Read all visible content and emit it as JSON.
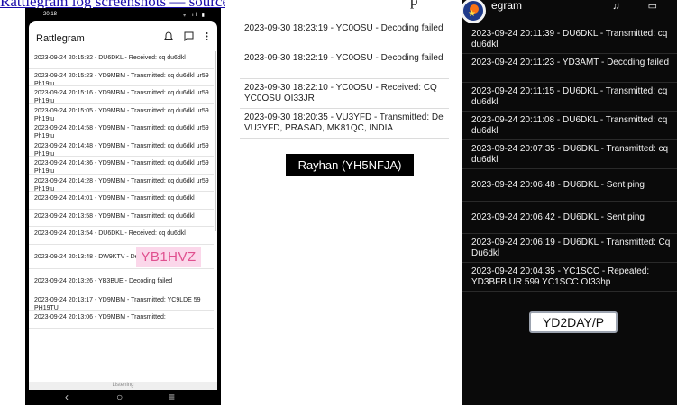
{
  "top": {
    "link_fragment": "Rattlegram log screenshots — source",
    "partial_text": "p"
  },
  "left_phone": {
    "status_time": "20:18",
    "status_icons": "ᯤ ıl ▮",
    "app_title": "Rattlegram",
    "bell_icon": "bell-icon",
    "chat_icon": "chat-icon",
    "menu_icon": "more-vert-icon",
    "rows": [
      "2023-09-24 20:15:32 - DU6DKL - Received: cq du6dkl",
      "2023-09-24 20:15:23 - YD9MBM - Transmitted: cq du6dkl ur59 Ph19tu",
      "2023-09-24 20:15:16 - YD9MBM - Transmitted: cq du6dkl ur59 Ph19tu",
      "2023-09-24 20:15:05 - YD9MBM - Transmitted: cq du6dkl ur59 Ph19tu",
      "2023-09-24 20:14:58 - YD9MBM - Transmitted: cq du6dkl ur59 Ph19tu",
      "2023-09-24 20:14:48 - YD9MBM - Transmitted: cq du6dkl ur59 Ph19tu",
      "2023-09-24 20:14:36 - YD9MBM - Transmitted: cq du6dkl ur59 Ph19tu",
      "2023-09-24 20:14:28 - YD9MBM - Transmitted: cq du6dkl ur59 Ph19tu",
      "2023-09-24 20:14:01 - YD9MBM - Transmitted: cq du6dkl",
      "2023-09-24 20:13:58 - YD9MBM - Transmitted: cq du6dkl",
      "2023-09-24 20:13:54 - DU6DKL - Received: cq du6dkl",
      "2023-09-24 20:13:48 - DW9KTV - Decoding failed",
      "2023-09-24 20:13:26 - YB3BUE - Decoding failed",
      "2023-09-24 20:13:17 - YD9MBM - Transmitted: YC9LDE 59 PH19TU",
      "2023-09-24 20:13:06 - YD9MBM - Transmitted:"
    ],
    "status_bar_text": "Listening",
    "nav": {
      "back": "‹",
      "home": "○",
      "recents": "≡"
    },
    "tag": "YB1HVZ"
  },
  "middle": {
    "rows": [
      "2023-09-30 18:23:19 - YC0OSU - Decoding failed",
      "2023-09-30 18:22:19 - YC0OSU - Decoding failed",
      "2023-09-30 18:22:10 - YC0OSU - Received: CQ YC0OSU OI33JR",
      "2023-09-30 18:20:35 - VU3YFD - Transmitted: De VU3YFD, PRASAD, MK81QC, INDIA"
    ],
    "tag": "Rayhan (YH5NFJA)"
  },
  "right_phone": {
    "app_title": "egram",
    "icons": "♫ ▭",
    "rows": [
      "2023-09-24 20:11:39 - DU6DKL - Transmitted: cq du6dkl",
      "2023-09-24 20:11:23 - YD3AMT - Decoding failed",
      "2023-09-24 20:11:15 - DU6DKL - Transmitted: cq du6dkl",
      "2023-09-24 20:11:08 - DU6DKL - Transmitted: cq du6dkl",
      "2023-09-24 20:07:35 - DU6DKL - Transmitted: cq du6dkl",
      "2023-09-24 20:06:48 - DU6DKL - Sent ping",
      "2023-09-24 20:06:42 - DU6DKL - Sent ping",
      "2023-09-24 20:06:19 - DU6DKL - Transmitted: Cq Du6dkl",
      "2023-09-24 20:04:35 - YC1SCC - Repeated: YD3BFB UR 599 YC1SCC OI33hp"
    ],
    "tag": "YD2DAY/P"
  }
}
